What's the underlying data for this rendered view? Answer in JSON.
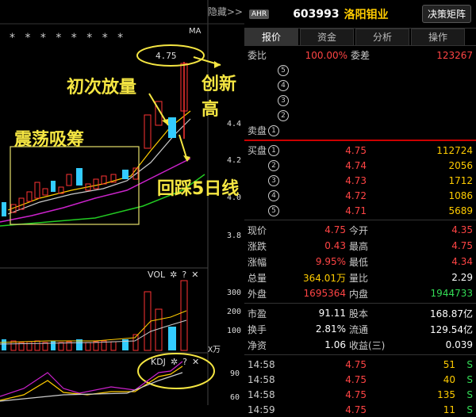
{
  "chart": {
    "hide_label": "隐藏>>",
    "ma_label": "MA",
    "stars": "* * *   *   * *         * *",
    "price_ticks": [
      "4.4",
      "4.2",
      "4.0",
      "3.8"
    ],
    "peak_label": "4.75",
    "annotations": {
      "first_volume": "初次放量",
      "new_high": "创新高",
      "accumulation": "震荡吸筹",
      "pullback": "回踩5日线"
    },
    "vol_header": "VOL",
    "vol_ticks": [
      "300",
      "200",
      "100"
    ],
    "vol_unit": "X万",
    "kdj_header": "KDJ",
    "kdj_ticks": [
      "90",
      "60"
    ],
    "gear_icon": "✲",
    "help_icon": "?",
    "close_icon": "✕"
  },
  "header": {
    "badge": "AHR",
    "code": "603993",
    "name": "洛阳钼业",
    "decision_button": "决策矩阵"
  },
  "tabs": [
    "报价",
    "资金",
    "分析",
    "操作"
  ],
  "weibi": {
    "label": "委比",
    "value": "100.00%",
    "label2": "委差",
    "value2": "123267"
  },
  "sell_rows": [
    {
      "label": "",
      "num": "5"
    },
    {
      "label": "",
      "num": "4"
    },
    {
      "label": "",
      "num": "3"
    },
    {
      "label": "",
      "num": "2"
    },
    {
      "label": "卖盘",
      "num": "1"
    }
  ],
  "buy_rows": [
    {
      "label": "买盘",
      "num": "1",
      "price": "4.75",
      "vol": "112724"
    },
    {
      "label": "",
      "num": "2",
      "price": "4.74",
      "vol": "2056"
    },
    {
      "label": "",
      "num": "3",
      "price": "4.73",
      "vol": "1712"
    },
    {
      "label": "",
      "num": "4",
      "price": "4.72",
      "vol": "1086"
    },
    {
      "label": "",
      "num": "5",
      "price": "4.71",
      "vol": "5689"
    }
  ],
  "quote": [
    {
      "l1": "现价",
      "v1": "4.75",
      "c1": "red",
      "l2": "今开",
      "v2": "4.35",
      "c2": "red"
    },
    {
      "l1": "涨跌",
      "v1": "0.43",
      "c1": "red",
      "l2": "最高",
      "v2": "4.75",
      "c2": "red"
    },
    {
      "l1": "涨幅",
      "v1": "9.95%",
      "c1": "red",
      "l2": "最低",
      "v2": "4.34",
      "c2": "red"
    },
    {
      "l1": "总量",
      "v1": "364.01万",
      "c1": "yellow",
      "l2": "量比",
      "v2": "2.29",
      "c2": "white"
    },
    {
      "l1": "外盘",
      "v1": "1695364",
      "c1": "red",
      "l2": "内盘",
      "v2": "1944733",
      "c2": "green"
    }
  ],
  "fundamentals": [
    {
      "l1": "市盈",
      "v1": "91.11",
      "l2": "股本",
      "v2": "168.87亿"
    },
    {
      "l1": "换手",
      "v1": "2.81%",
      "l2": "流通",
      "v2": "129.54亿"
    },
    {
      "l1": "净资",
      "v1": "1.06",
      "l2": "收益(三)",
      "v2": "0.039"
    }
  ],
  "ticks": [
    {
      "time": "14:58",
      "price": "4.75",
      "vol": "51",
      "flag": "S"
    },
    {
      "time": "14:58",
      "price": "4.75",
      "vol": "40",
      "flag": "S"
    },
    {
      "time": "14:58",
      "price": "4.75",
      "vol": "135",
      "flag": "S"
    },
    {
      "time": "14:59",
      "price": "4.75",
      "vol": "11",
      "flag": "S"
    }
  ]
}
